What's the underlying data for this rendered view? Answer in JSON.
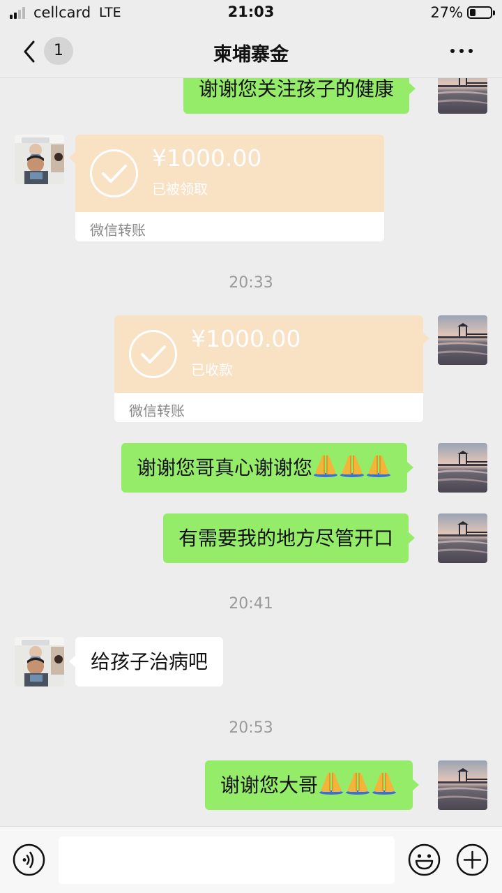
{
  "status_bar": {
    "carrier": "cellcard",
    "network": "LTE",
    "time": "21:03",
    "battery_percent": "27%",
    "battery_level": 0.27
  },
  "nav": {
    "unread_count": "1",
    "title": "柬埔寨金"
  },
  "messages": [
    {
      "type": "text",
      "from": "self",
      "text": "谢谢您关注孩子的健康"
    },
    {
      "type": "transfer",
      "from": "other",
      "amount": "¥1000.00",
      "status": "已被领取",
      "label": "微信转账"
    },
    {
      "type": "time",
      "text": "20:33"
    },
    {
      "type": "transfer",
      "from": "self",
      "amount": "¥1000.00",
      "status": "已收款",
      "label": "微信转账"
    },
    {
      "type": "text",
      "from": "self",
      "text": "谢谢您哥真心谢谢您",
      "emoji": [
        "pray-emoji",
        "pray-emoji",
        "pray-emoji"
      ]
    },
    {
      "type": "text",
      "from": "self",
      "text": "有需要我的地方尽管开口"
    },
    {
      "type": "time",
      "text": "20:41"
    },
    {
      "type": "text",
      "from": "other",
      "text": "给孩子治病吧"
    },
    {
      "type": "time",
      "text": "20:53"
    },
    {
      "type": "text",
      "from": "self",
      "text": "谢谢您大哥",
      "emoji": [
        "pray-emoji",
        "pray-emoji",
        "pray-emoji"
      ]
    }
  ],
  "input": {
    "value": "",
    "placeholder": ""
  },
  "colors": {
    "background": "#ededed",
    "self_bubble": "#95ec69",
    "other_bubble": "#ffffff",
    "transfer_card": "#f9e1c4",
    "timestamp_text": "#9a9a9a"
  },
  "icons": [
    "back-icon",
    "more-icon",
    "check-icon",
    "voice-icon",
    "emoji-icon",
    "add-icon",
    "pray-emoji"
  ]
}
